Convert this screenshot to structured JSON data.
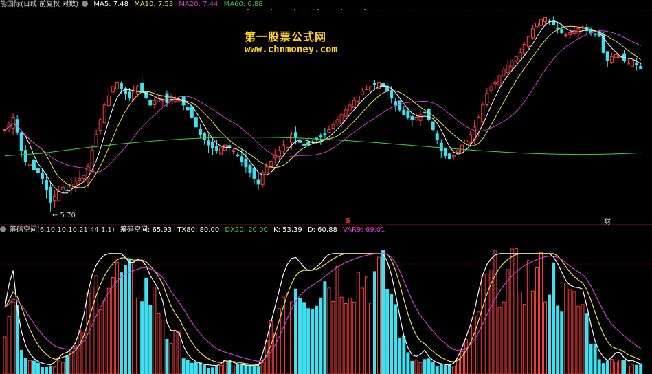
{
  "header": {
    "stock": "能国际(日线 前复权 对数)",
    "ma": [
      {
        "label": "MA5: 7.48",
        "color": "#ffffff"
      },
      {
        "label": "MA10: 7.53",
        "color": "#f0e060"
      },
      {
        "label": "MA20: 7.44",
        "color": "#d040d0"
      },
      {
        "label": "MA60: 6.88",
        "color": "#40d040"
      }
    ]
  },
  "watermark": {
    "title": "第一股票公式网",
    "url": "www.chnmoney.com"
  },
  "annotations": {
    "low_label": "← 5.70",
    "marker_s": "S",
    "marker_cai": "财"
  },
  "indicator_header": {
    "name": "筹码空间(6,10,10,10,21,44,1,1)",
    "items": [
      {
        "label": "筹码空间: 65.93",
        "color": "#ffffff"
      },
      {
        "label": "TX80: 80.00",
        "color": "#ffffff"
      },
      {
        "label": "DX20: 20.00",
        "color": "#40d040"
      },
      {
        "label": "K: 53.39",
        "color": "#ffffff"
      },
      {
        "label": "D: 60.88",
        "color": "#ffffff"
      },
      {
        "label": "VAR9: 69.01",
        "color": "#e040e0"
      }
    ]
  },
  "chart_data": {
    "type": "candlestick",
    "n": 152,
    "price_range": [
      5.5,
      9.8
    ],
    "indicator_range": [
      0,
      100
    ],
    "close": [
      7.1,
      7.2,
      7.35,
      7.05,
      6.7,
      6.5,
      6.45,
      6.35,
      6.3,
      6.2,
      6.0,
      5.8,
      5.9,
      6.0,
      6.05,
      6.0,
      6.1,
      6.15,
      6.2,
      6.25,
      6.4,
      6.7,
      7.0,
      7.3,
      7.6,
      7.8,
      8.0,
      8.1,
      7.95,
      7.85,
      7.75,
      7.9,
      8.0,
      7.9,
      7.75,
      7.6,
      7.7,
      7.75,
      7.8,
      7.65,
      7.7,
      7.75,
      7.7,
      7.6,
      7.5,
      7.35,
      7.15,
      7.0,
      6.9,
      6.8,
      6.75,
      6.7,
      6.75,
      6.8,
      6.75,
      6.7,
      6.6,
      6.5,
      6.4,
      6.3,
      6.2,
      6.1,
      6.3,
      6.4,
      6.5,
      6.6,
      6.7,
      6.8,
      6.9,
      7.0,
      6.95,
      6.85,
      6.8,
      6.8,
      6.85,
      6.9,
      6.95,
      7.0,
      7.1,
      7.2,
      7.3,
      7.4,
      7.5,
      7.6,
      7.7,
      7.8,
      7.9,
      7.95,
      8.0,
      8.05,
      8.1,
      8.0,
      7.9,
      7.75,
      7.6,
      7.5,
      7.4,
      7.35,
      7.3,
      7.35,
      7.4,
      7.45,
      7.3,
      7.1,
      6.9,
      6.7,
      6.6,
      6.55,
      6.6,
      6.7,
      6.8,
      6.9,
      7.0,
      7.15,
      7.35,
      7.6,
      7.85,
      8.0,
      8.1,
      8.25,
      8.4,
      8.5,
      8.6,
      8.7,
      8.8,
      9.0,
      9.2,
      9.4,
      9.55,
      9.65,
      9.7,
      9.6,
      9.5,
      9.4,
      9.3,
      9.25,
      9.3,
      9.35,
      9.4,
      9.45,
      9.35,
      9.3,
      9.25,
      9.2,
      8.8,
      8.6,
      8.7,
      8.75,
      8.7,
      8.6,
      8.55,
      8.6,
      8.5,
      8.4
    ],
    "ma5": 7.48,
    "ma10": 7.53,
    "ma20": 7.44,
    "ma60": 6.88,
    "low_point": 5.7,
    "indicator_values": {
      "筹码空间": 65.93,
      "TX80": 80.0,
      "DX20": 20.0,
      "K": 53.39,
      "D": 60.88,
      "VAR9": 69.01
    }
  },
  "colors": {
    "up": "#ff4040",
    "down": "#40e0f0",
    "ma5": "#ffffff",
    "ma10": "#f0e060",
    "ma20": "#d040d0",
    "ma60": "#40d040",
    "divider": "#b00000",
    "k": "#ffffff",
    "d": "#f0e060",
    "var9": "#d040d0"
  }
}
